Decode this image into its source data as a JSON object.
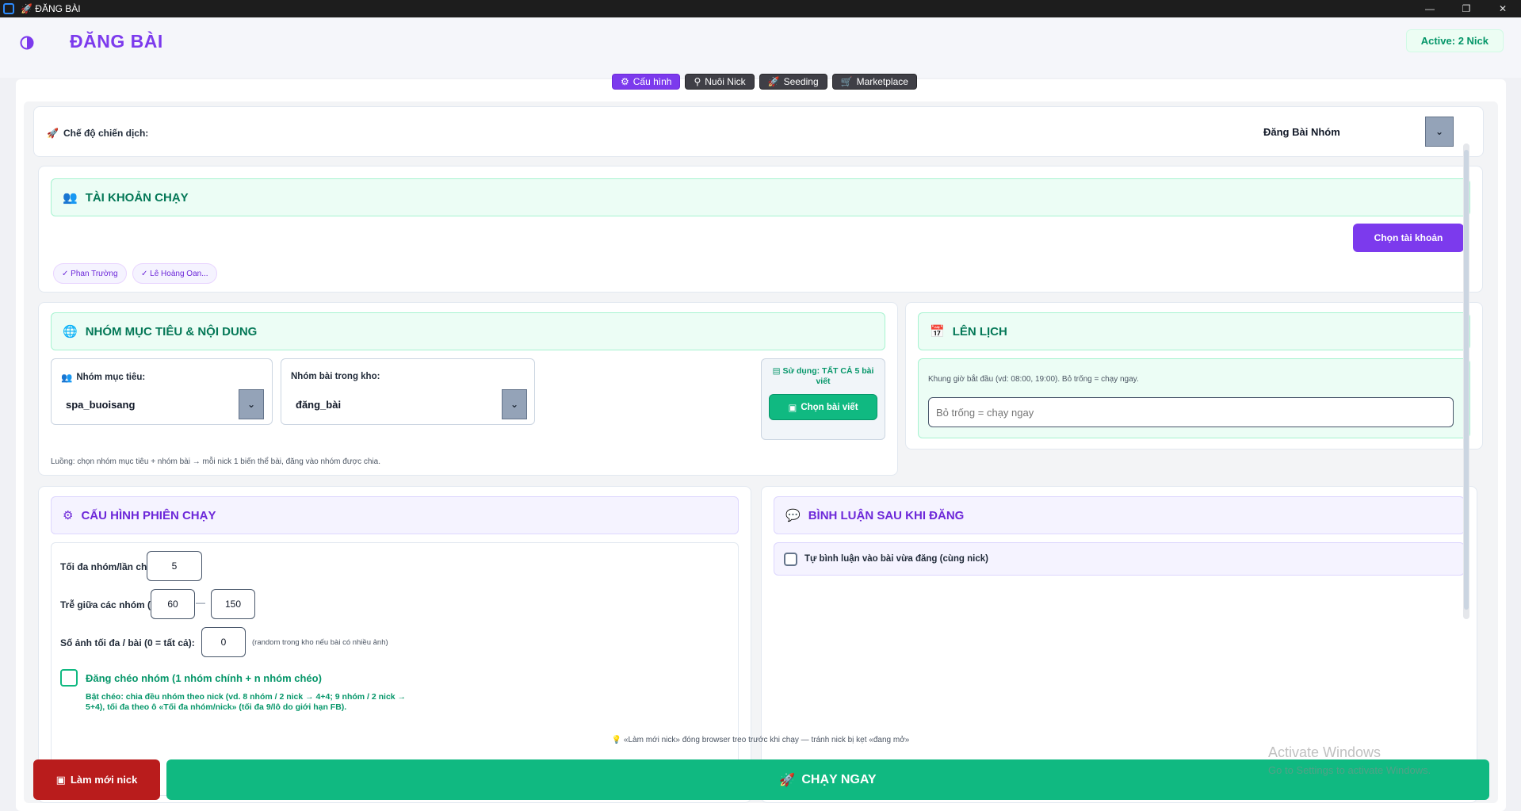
{
  "window": {
    "title": "🚀 ĐĂNG BÀI",
    "minimize": "—",
    "maximize": "❐",
    "close": "✕"
  },
  "header": {
    "title": "ĐĂNG BÀI",
    "active_badge": "Active: 2 Nick"
  },
  "tabs": [
    {
      "icon": "⚙",
      "label": "Cấu hình"
    },
    {
      "icon": "⚲",
      "label": "Nuôi Nick"
    },
    {
      "icon": "🚀",
      "label": "Seeding"
    },
    {
      "icon": "🛒",
      "label": "Marketplace"
    }
  ],
  "mode": {
    "icon": "🚀",
    "label": "Chế độ chiến dịch:",
    "selected": "Đăng Bài Nhóm",
    "caret": "⌄"
  },
  "accounts": {
    "icon": "👥",
    "title": "TÀI KHOẢN CHẠY",
    "select_button": "Chọn tài khoản",
    "chips": [
      "✓ Phan Trường",
      "✓ Lê Hoàng Oan..."
    ]
  },
  "targets": {
    "icon": "🌐",
    "title": "NHÓM MỤC TIÊU & NỘI DUNG",
    "group_label_icon": "👥",
    "group_label": "Nhóm mục tiêu:",
    "group_value": "spa_buoisang",
    "bank_label": "Nhóm bài trong kho:",
    "bank_value": "đăng_bài",
    "usage_icon": "▤",
    "usage_text": "Sử dụng: TẤT CẢ 5 bài viết",
    "pick_icon": "▣",
    "pick_button": "Chọn bài viết",
    "flow_hint": "Luồng: chọn nhóm mục tiêu + nhóm bài → mỗi nick 1 biến thể bài, đăng vào nhóm được chia."
  },
  "schedule": {
    "icon": "📅",
    "title": "LÊN LỊCH",
    "hint": "Khung giờ bắt đầu (vd: 08:00, 19:00). Bỏ trống = chạy ngay.",
    "placeholder": "Bỏ trống = chạy ngay"
  },
  "session": {
    "icon": "⚙",
    "title": "CẤU HÌNH PHIÊN CHẠY",
    "max_groups_label": "Tối đa nhóm/lần chạy:",
    "max_groups_value": "5",
    "delay_label": "Trễ giữa các nhóm (s):",
    "delay_min": "60",
    "delay_sep": "—",
    "delay_max": "150",
    "max_images_label": "Số ảnh tối đa / bài (0 = tất cả):",
    "max_images_value": "0",
    "max_images_hint": "(random trong kho nếu bài có nhiều ảnh)",
    "cross_label": "Đăng chéo nhóm (1 nhóm chính + n nhóm chéo)",
    "cross_hint": "Bật chéo: chia đều nhóm theo nick (vd. 8 nhóm / 2 nick → 4+4; 9 nhóm / 2 nick → 5+4), tối đa theo ô «Tối đa nhóm/nick» (tối đa 9/lô do giới hạn FB)."
  },
  "comment": {
    "icon": "💬",
    "title": "BÌNH LUẬN SAU KHI ĐĂNG",
    "auto_label": "Tự bình luận vào bài vừa đăng (cùng nick)"
  },
  "footer": {
    "note": "💡 «Làm mới nick» đóng browser treo trước khi chạy — tránh nick bị kẹt «đang mở»",
    "refresh_icon": "▣",
    "refresh_button": "Làm mới nick",
    "run_icon": "🚀",
    "run_button": "CHẠY NGAY"
  },
  "watermark": {
    "line1": "Activate Windows",
    "line2": "Go to Settings to activate Windows."
  },
  "colors": {
    "accent": "#7c3aed",
    "success": "#10b981",
    "danger": "#b91c1c"
  }
}
